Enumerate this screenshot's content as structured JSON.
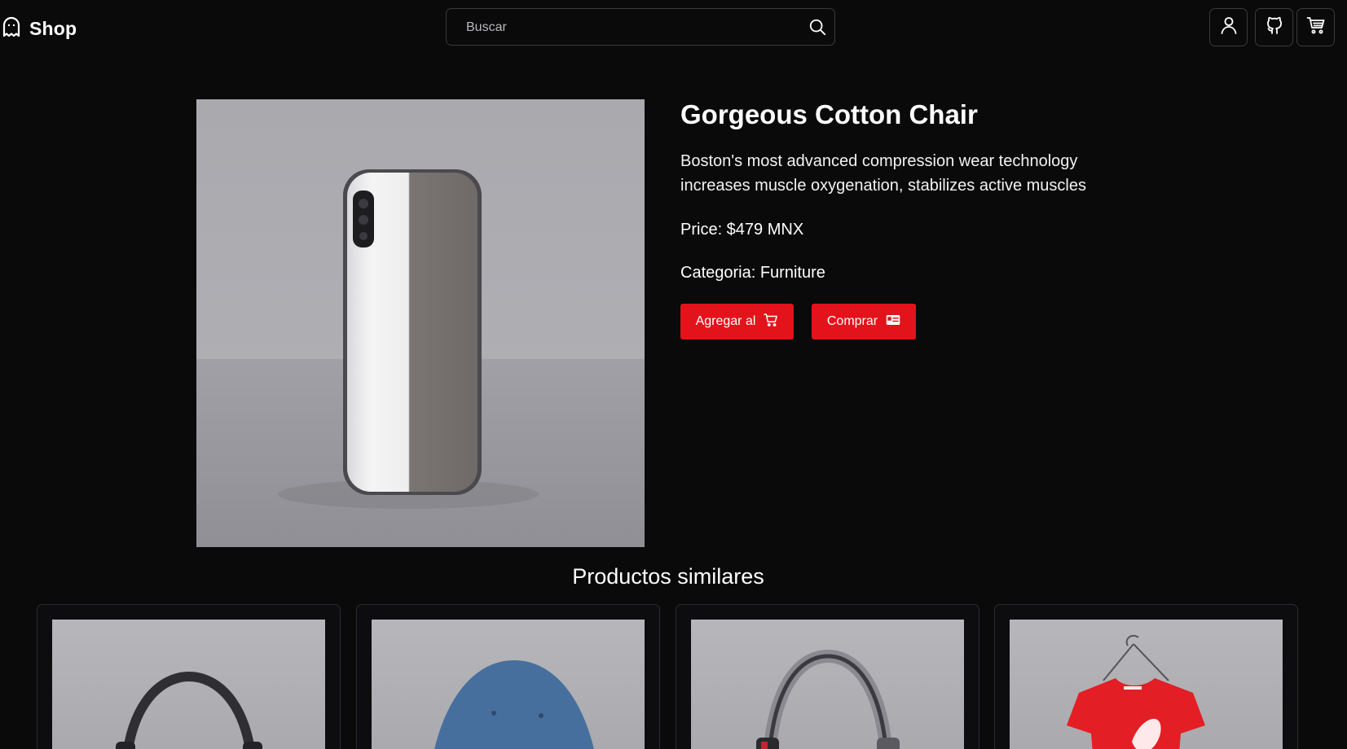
{
  "header": {
    "logo_text": "Shop",
    "logo_icon": "ghost-icon",
    "search_placeholder": "Buscar",
    "icons": [
      "user-icon",
      "github-icon",
      "cart-icon"
    ]
  },
  "product": {
    "title": "Gorgeous Cotton Chair",
    "description": "Boston's most advanced compression wear technology increases muscle oxygenation, stabilizes active muscles",
    "price": "Price: $479 MNX",
    "category": "Categoria: Furniture",
    "image_alt": "product image",
    "add_button_label": "Agregar al",
    "buy_button_label": "Comprar"
  },
  "similar": {
    "heading": "Productos similares",
    "items": [
      {
        "image": "headphones"
      },
      {
        "image": "cap"
      },
      {
        "image": "headphones"
      },
      {
        "image": "t-shirt"
      }
    ]
  },
  "colors": {
    "background": "#0a0a0b",
    "accent": "#e3131b",
    "border": "#3a3a3e"
  }
}
